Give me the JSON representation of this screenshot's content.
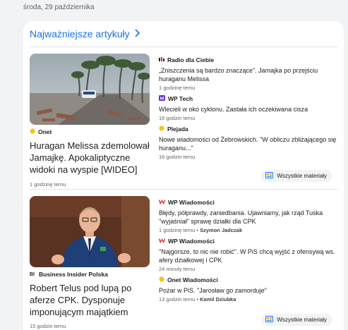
{
  "date": "środa, 29 października",
  "section": {
    "title": "Najważniejsze artykuły"
  },
  "stories": [
    {
      "hero": {
        "source": "Onet",
        "title": "Huragan Melissa zdemolował Jamajkę. Apokaliptyczne widoki na wyspie [WIDEO]",
        "time": "1 godzinę temu"
      },
      "items": [
        {
          "source": "Radio dla Ciebie",
          "title": "„Zniszczenia są bardzo znaczące”. Jamajka po przejściu huraganu Melissa",
          "time": "1 godzinę temu",
          "author": ""
        },
        {
          "source": "WP Tech",
          "title": "Wlecieli w oko cyklonu. Zastała ich oczekiwana cisza",
          "time": "16 godzin temu",
          "author": ""
        },
        {
          "source": "Plejada",
          "title": "Nowe wiadomości od Żebrowskich. \"W obliczu zbliżającego się huraganu...\"",
          "time": "16 godzin temu",
          "author": ""
        }
      ],
      "all_label": "Wszystkie materiały"
    },
    {
      "hero": {
        "source": "Business Insider Polska",
        "title": "Robert Telus pod lupą po aferze CPK. Dysponuje imponującym majątkiem",
        "time": "15 godzin temu"
      },
      "items": [
        {
          "source": "WP Wiadomości",
          "title": "Błędy, półprawdy, zaniedbania. Ujawniamy, jak rząd Tuska \"wyjaśniał\" sprawę działki dla CPK",
          "time": "1 godzinę temu",
          "author": "Szymon Jadczak"
        },
        {
          "source": "WP Wiadomości",
          "title": "\"Najgorsze, to nic nie robić\". W PiS chcą wyjść z ofensywą ws. afery działkowej i CPK",
          "time": "24 minuty temu",
          "author": ""
        },
        {
          "source": "Onet Wiadomości",
          "title": "Pożar w PiS. \"Jarosław go zamorduje\"",
          "time": "13 godzin temu",
          "author": "Kamil Dziubka"
        }
      ],
      "all_label": "Wszystkie materiały"
    }
  ],
  "sep": "•",
  "colors": {
    "accent": "#1a73e8",
    "onet": "#f9c11a",
    "wp": "#e4212b",
    "plejada": "#f5c518"
  }
}
